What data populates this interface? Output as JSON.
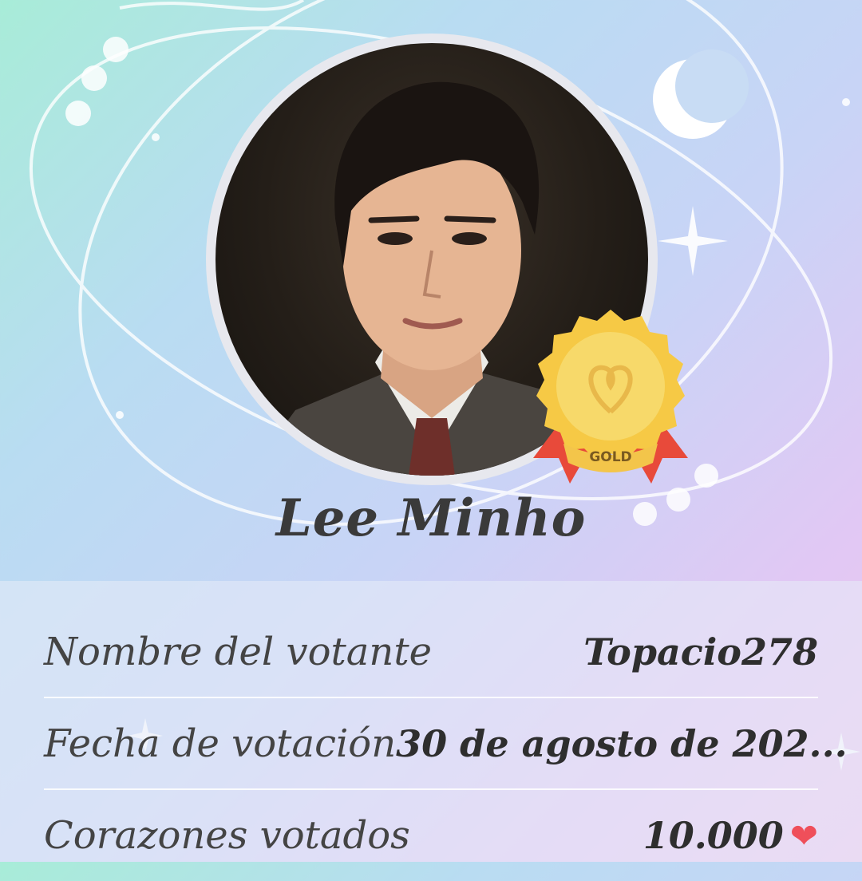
{
  "profile": {
    "name": "Lee Minho",
    "badge_text": "GOLD"
  },
  "vote": {
    "voter_label": "Nombre del votante",
    "voter_value": "Topacio278",
    "date_label": "Fecha de votación",
    "date_value": "30 de agosto de 202...",
    "hearts_label": "Corazones votados",
    "hearts_value": "10.000"
  },
  "icons": {
    "hearts_icon": "heart-icon",
    "badge_icon": "gold-medal-icon",
    "moon": "crescent-moon-icon",
    "sparkle": "sparkle-star-icon"
  },
  "colors": {
    "heart": "#ef4f5a",
    "gold": "#f4c542",
    "ribbon": "#e84a3a"
  }
}
